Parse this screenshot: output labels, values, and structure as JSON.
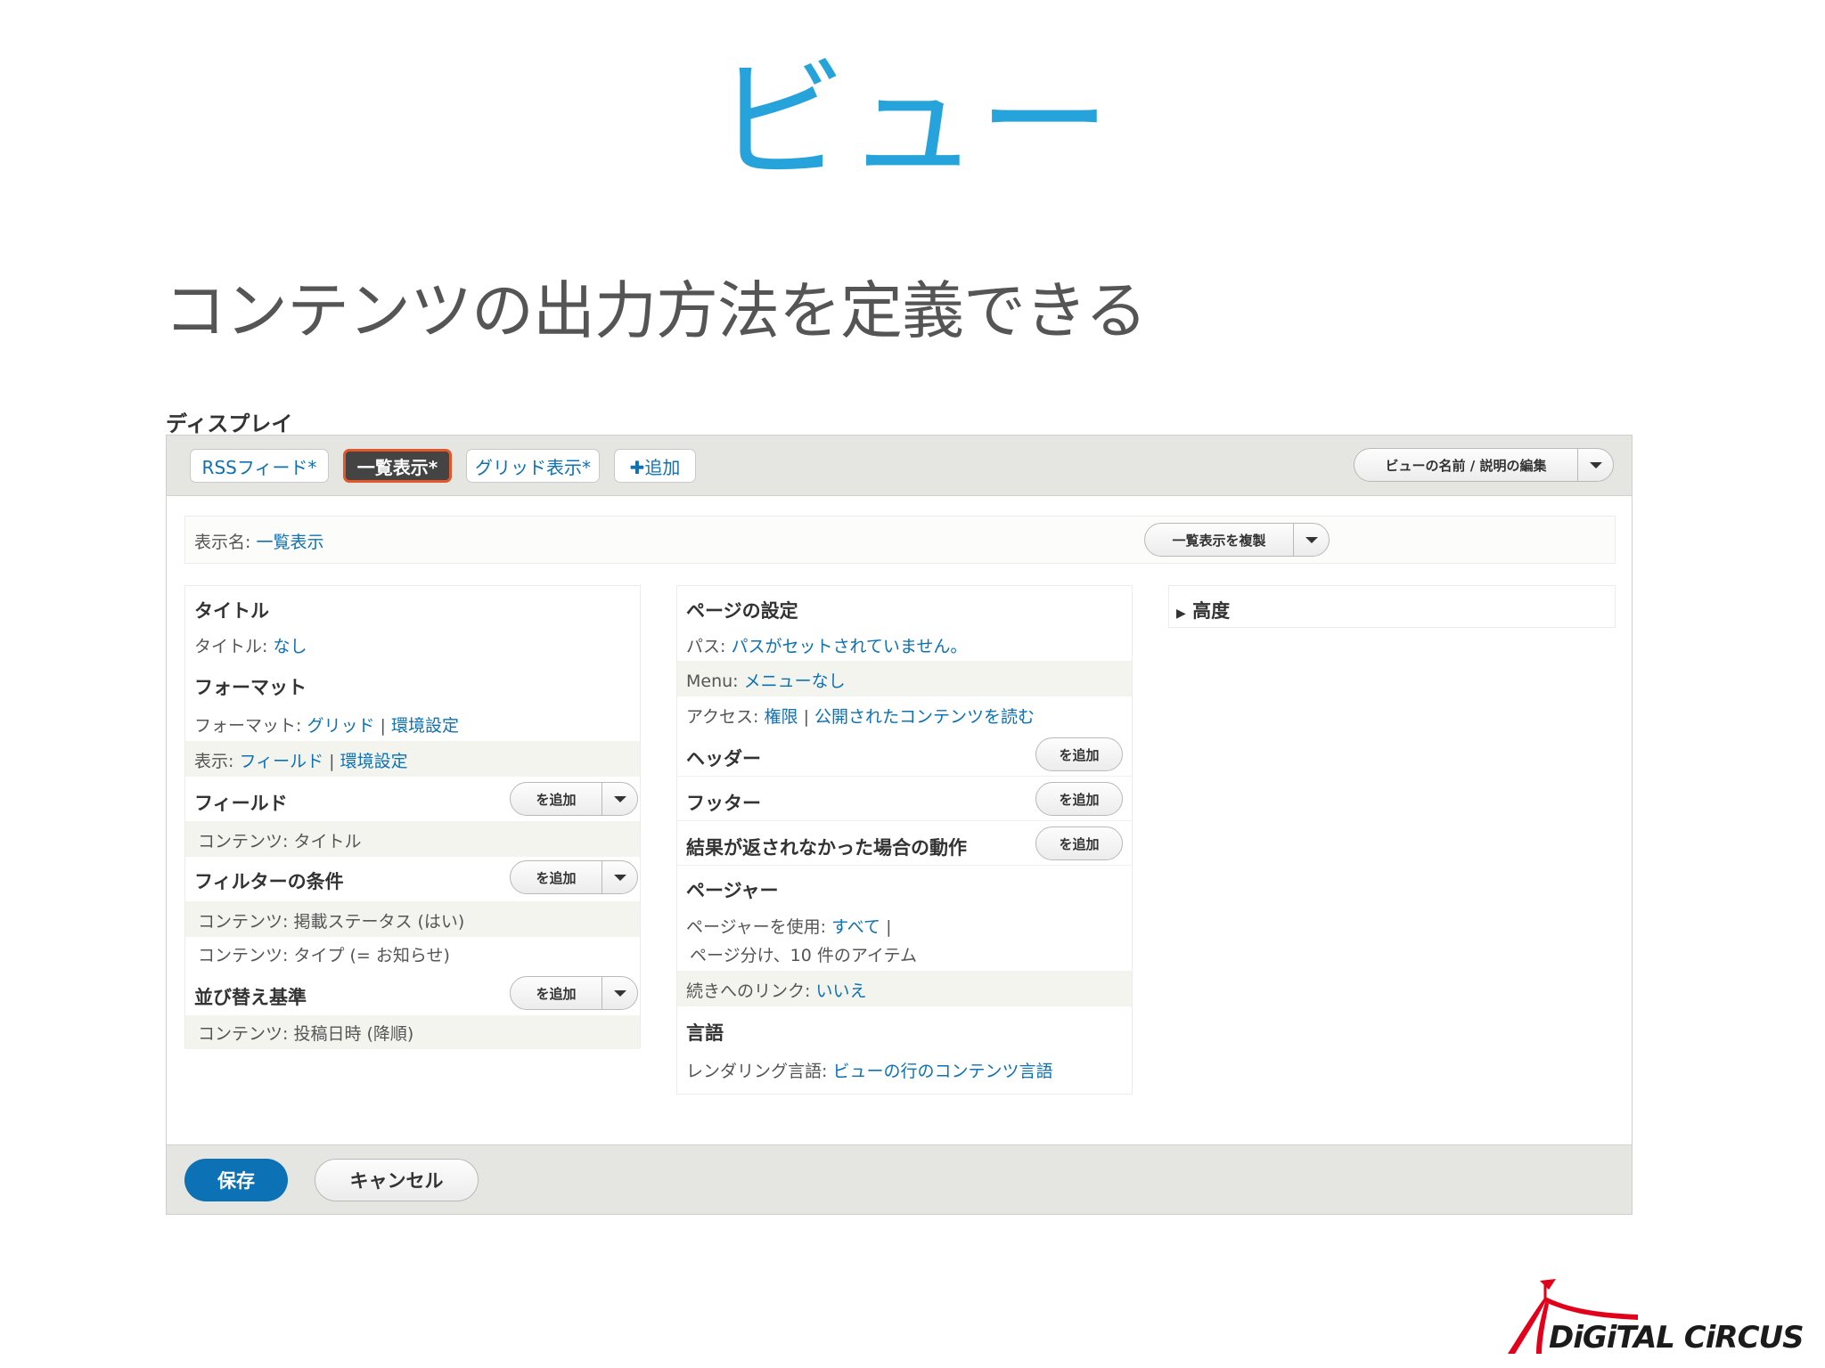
{
  "slide": {
    "title": "ビュー",
    "subtitle": "コンテンツの出力方法を定義できる"
  },
  "display_label": "ディスプレイ",
  "tabs": [
    {
      "label": "RSSフィード*"
    },
    {
      "label": "一覧表示*",
      "active": true
    },
    {
      "label": "グリッド表示*"
    },
    {
      "label": "✚追加"
    }
  ],
  "edit_view_button": "ビューの名前 / 説明の編集",
  "display_name": {
    "label": "表示名:",
    "value": "一覧表示"
  },
  "duplicate_button": "一覧表示を複製",
  "left_column": {
    "title_heading": "タイトル",
    "title_row": {
      "label": "タイトル:",
      "value": "なし"
    },
    "format_heading": "フォーマット",
    "format_row": {
      "label": "フォーマット:",
      "value": "グリッド",
      "sep": "|",
      "settings": "環境設定"
    },
    "show_row": {
      "label": "表示:",
      "value": "フィールド",
      "sep": "|",
      "settings": "環境設定"
    },
    "fields_heading": "フィールド",
    "fields_item": "コンテンツ: タイトル",
    "filter_heading": "フィルターの条件",
    "filter_items": [
      "コンテンツ: 掲載ステータス (はい)",
      "コンテンツ: タイプ (= お知らせ)"
    ],
    "sort_heading": "並び替え基準",
    "sort_item": "コンテンツ: 投稿日時 (降順)",
    "add_label": "を追加"
  },
  "middle_column": {
    "page_heading": "ページの設定",
    "path_row": {
      "label": "パス:",
      "value": "パスがセットされていません。"
    },
    "menu_row": {
      "label": "Menu:",
      "value": "メニューなし"
    },
    "access_row": {
      "label": "アクセス:",
      "value": "権限",
      "sep": "|",
      "value2": "公開されたコンテンツを読む"
    },
    "header_heading": "ヘッダー",
    "footer_heading": "フッター",
    "noresult_heading": "結果が返されなかった場合の動作",
    "pager_heading": "ページャー",
    "pager_row": {
      "label": "ページャーを使用:",
      "value": "すべて",
      "sep": "|",
      "value2": "ページ分け、10 件のアイテム"
    },
    "more_row": {
      "label": "続きへのリンク:",
      "value": "いいえ"
    },
    "lang_heading": "言語",
    "lang_row": {
      "label": "レンダリング言語:",
      "value": "ビューの行のコンテンツ言語"
    },
    "add_label": "を追加"
  },
  "right_column": {
    "advanced_heading": "高度"
  },
  "footer": {
    "save_label": "保存",
    "cancel_label": "キャンセル"
  },
  "brand": {
    "text": "DiGiTAL CiRCUS",
    "color": "#e2001a"
  },
  "colors": {
    "title": "#27a3dc",
    "link": "#0d71b5",
    "active_tab_border": "#e4572b"
  }
}
